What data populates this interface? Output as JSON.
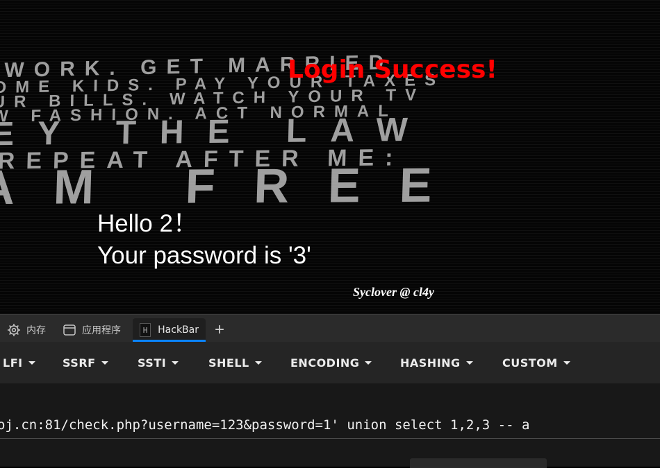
{
  "page": {
    "background_words": [
      "WORK. GET MARRIED",
      "OME KIDS. PAY YOUR TAXES",
      "UR BILLS. WATCH YOUR TV",
      "W FASHION. ACT NORMAL",
      "EY THE LAW",
      "REPEAT AFTER ME:",
      "AM FREE"
    ],
    "login_message": "Login Success!",
    "hello_line": "Hello 2！",
    "password_line": "Your password is '3'",
    "signature": "Syclover @ cl4y",
    "colors": {
      "login": "#ff0000",
      "text": "#ffffff"
    }
  },
  "devtools": {
    "tabs": [
      {
        "label": "内存",
        "icon": "gear-chip-icon",
        "active": false
      },
      {
        "label": "应用程序",
        "icon": "window-icon",
        "active": false
      },
      {
        "label": "HackBar",
        "icon": "hackbar-logo-icon",
        "active": true
      }
    ],
    "hackbar_badge": "H",
    "add_tab_label": "+",
    "accent": "#0a84ff"
  },
  "hackbar": {
    "menu": [
      {
        "label": "LFI"
      },
      {
        "label": "SSRF"
      },
      {
        "label": "SSTI"
      },
      {
        "label": "SHELL"
      },
      {
        "label": "ENCODING"
      },
      {
        "label": "HASHING"
      },
      {
        "label": "CUSTOM"
      }
    ],
    "url_value": "oj.cn:81/check.php?username=123&password=1' union select 1,2,3 -- a"
  }
}
